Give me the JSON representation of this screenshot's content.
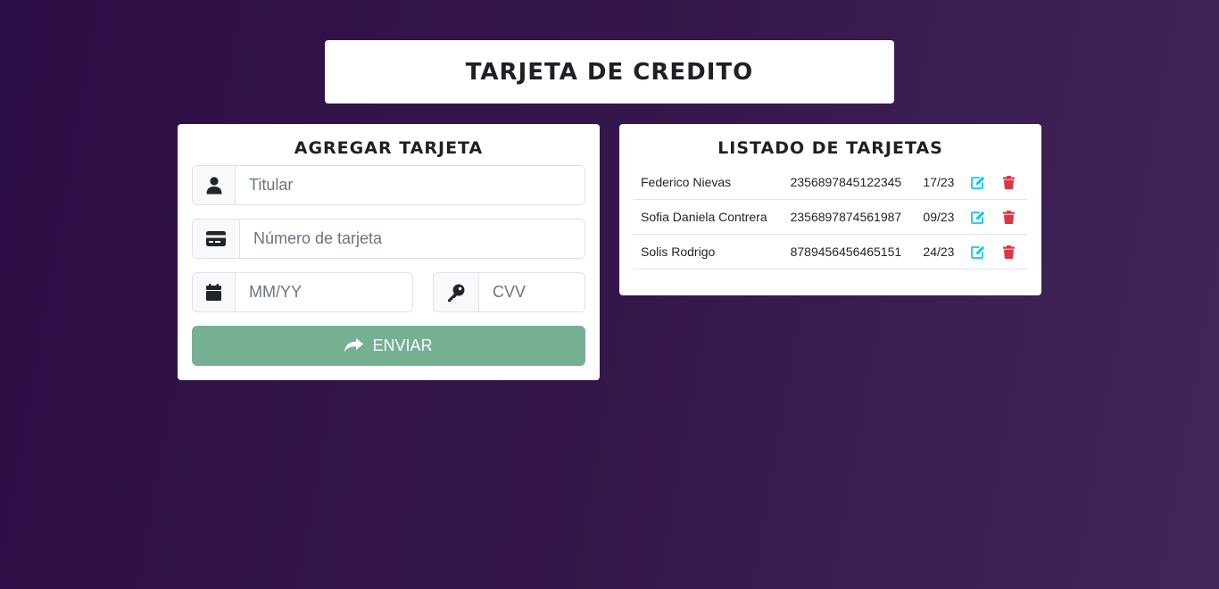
{
  "header": {
    "title": "TARJETA DE CREDITO"
  },
  "form": {
    "title": "AGREGAR TARJETA",
    "titular_placeholder": "Titular",
    "numero_placeholder": "Número de tarjeta",
    "fecha_placeholder": "MM/YY",
    "cvv_placeholder": "CVV",
    "submit_label": "ENVIAR",
    "submit_color": "#75b093"
  },
  "list": {
    "title": "LISTADO DE TARJETAS",
    "rows": [
      {
        "titular": "Federico Nievas",
        "numero": "2356897845122345",
        "fecha": "17/23"
      },
      {
        "titular": "Sofia Daniela Contrera",
        "numero": "2356897874561987",
        "fecha": "09/23"
      },
      {
        "titular": "Solis Rodrigo",
        "numero": "8789456456465151",
        "fecha": "24/23"
      }
    ],
    "edit_icon": "edit-icon",
    "delete_icon": "trash-icon",
    "edit_color": "#0dcaf0",
    "delete_color": "#dc3545"
  },
  "colors": {
    "background": "#2c0e46",
    "card": "#ffffff"
  }
}
